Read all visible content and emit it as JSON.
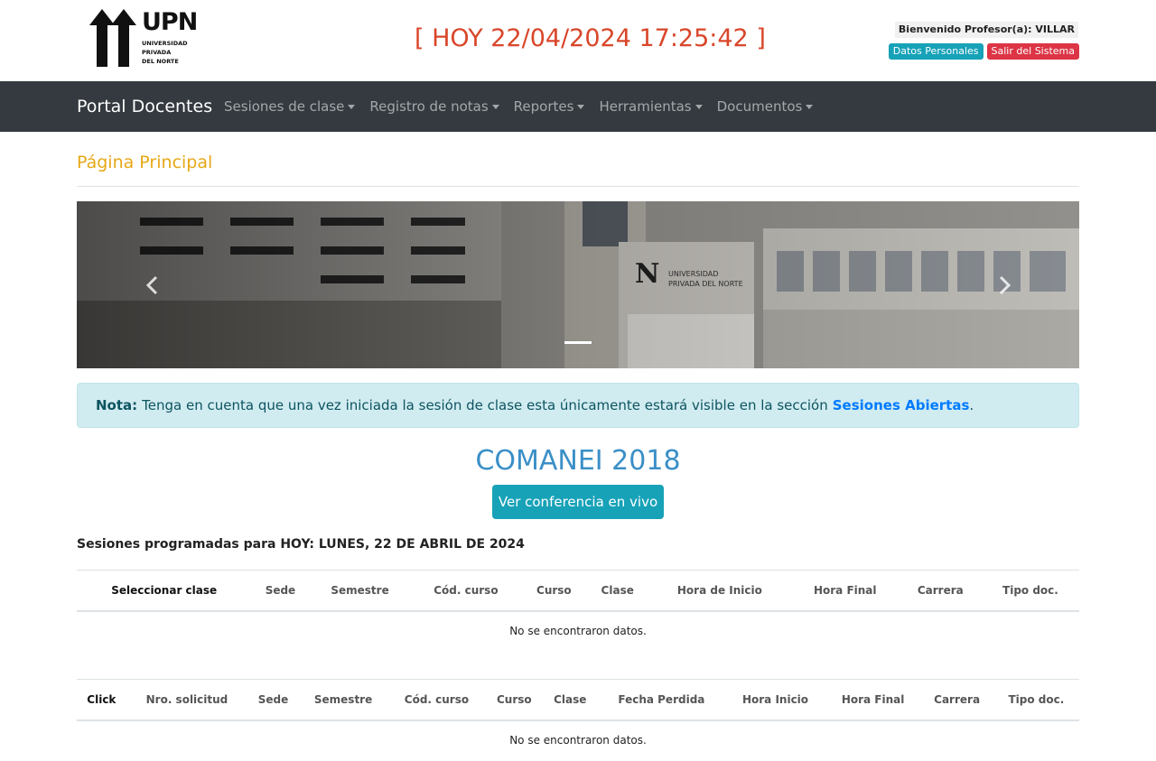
{
  "header": {
    "logo_text": "UPN",
    "logo_subtext": "UNIVERSIDAD\nPRIVADA\nDEL NORTE",
    "clock": "[ HOY 22/04/2024 17:25:42 ]",
    "welcome_label": "Bienvenido Profesor(a): VILLAR",
    "personal_data_button": "Datos Personales",
    "logout_button": "Salir del Sistema"
  },
  "navbar": {
    "brand": "Portal Docentes",
    "items": [
      {
        "label": "Sesiones de clase"
      },
      {
        "label": "Registro de notas"
      },
      {
        "label": "Reportes"
      },
      {
        "label": "Herramientas"
      },
      {
        "label": "Documentos"
      }
    ]
  },
  "main": {
    "page_title": "Página Principal",
    "carousel_banner_text": "UNIVERSIDAD\nPRIVADA DEL NORTE",
    "alert": {
      "label": "Nota:",
      "text": "Tenga en cuenta que una vez iniciada la sesión de clase esta únicamente estará visible en la sección",
      "link": "Sesiones Abiertas",
      "suffix": "."
    },
    "conference_title": "COMANEI 2018",
    "conference_button": "Ver conferencia en vivo",
    "sessions_title": "Sesiones programadas para HOY: LUNES, 22 DE ABRIL DE 2024",
    "table1": {
      "headers": [
        "Seleccionar clase",
        "Sede",
        "Semestre",
        "Cód. curso",
        "Curso",
        "Clase",
        "Hora de Inicio",
        "Hora Final",
        "Carrera",
        "Tipo doc."
      ],
      "empty": "No se encontraron datos."
    },
    "table2": {
      "headers": [
        "Click",
        "Nro. solicitud",
        "Sede",
        "Semestre",
        "Cód. curso",
        "Curso",
        "Clase",
        "Fecha Perdida",
        "Hora Inicio",
        "Hora Final",
        "Carrera",
        "Tipo doc."
      ],
      "empty": "No se encontraron datos."
    }
  },
  "colors": {
    "navbar_bg": "#343a40",
    "clock": "#d9462a",
    "page_title": "#e6a817",
    "info": "#17a2b8",
    "danger": "#dc3545",
    "alert_bg": "#d1ecf1",
    "link": "#007bff"
  }
}
